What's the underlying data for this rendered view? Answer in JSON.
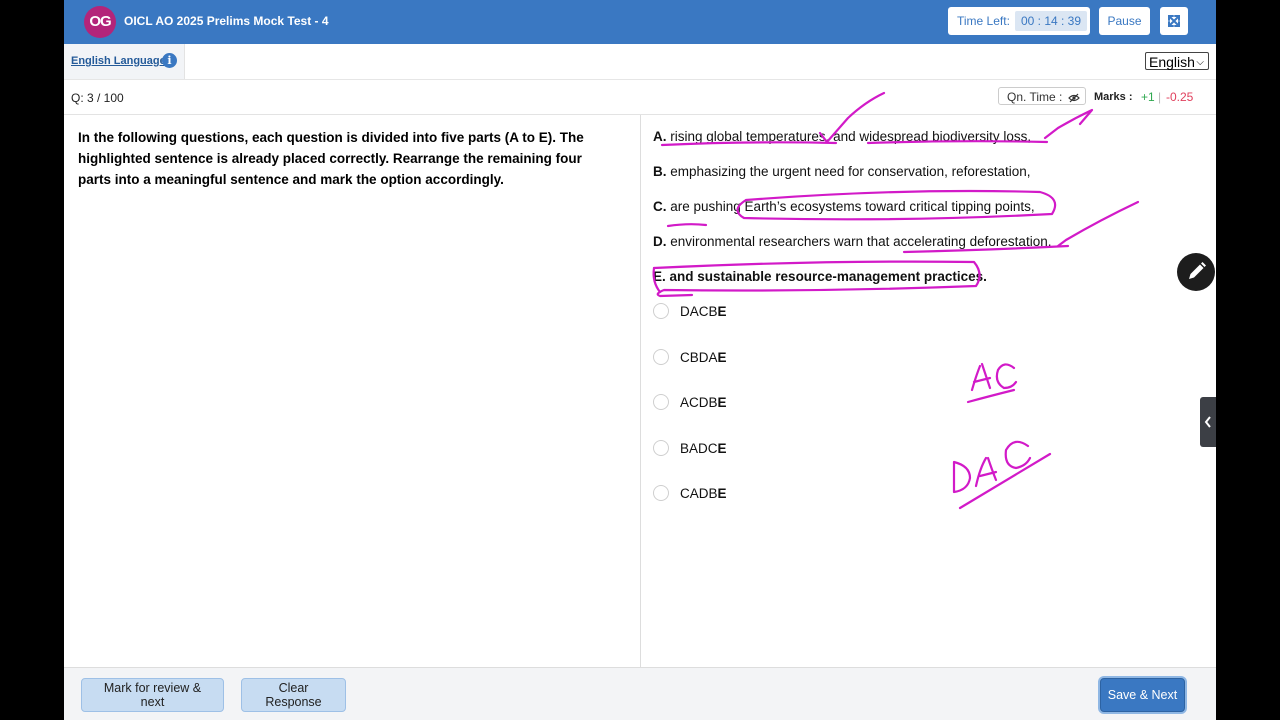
{
  "header": {
    "logo_text": "OG",
    "title": "OICL AO 2025 Prelims Mock Test - 4",
    "time_left_label": "Time Left:",
    "time_left_value": "00 : 14 : 39",
    "pause_label": "Pause"
  },
  "section": {
    "name": "English Language",
    "info_glyph": "i"
  },
  "language": {
    "selected": "English"
  },
  "question_bar": {
    "number": "Q: 3 / 100",
    "qn_time_label": "Qn. Time :",
    "marks_label": "Marks :",
    "positive": "+1",
    "separator": "|",
    "negative": "-0.25"
  },
  "question": {
    "text": "In the following questions, each question is divided into five parts (A to E). The highlighted sentence is already placed correctly. Rearrange the remaining four parts into a meaningful sentence and mark the option accordingly.",
    "parts": [
      {
        "letter": "A.",
        "text": " rising global temperatures, and widespread biodiversity loss,"
      },
      {
        "letter": "B.",
        "text": " emphasizing the urgent need for conservation, reforestation,"
      },
      {
        "letter": "C.",
        "text": " are pushing Earth’s ecosystems toward critical tipping points,"
      },
      {
        "letter": "D.",
        "text": " environmental researchers warn that accelerating deforestation,"
      },
      {
        "letter": "E.",
        "text": " and sustainable resource-management practices."
      }
    ],
    "options": [
      {
        "prefix": "DACB",
        "suffix": "E"
      },
      {
        "prefix": "CBDA",
        "suffix": "E"
      },
      {
        "prefix": "ACDB",
        "suffix": "E"
      },
      {
        "prefix": "BADC",
        "suffix": "E"
      },
      {
        "prefix": "CADB",
        "suffix": "E"
      }
    ]
  },
  "footer": {
    "mark_review_label": "Mark for review & next",
    "clear_label": "Clear Response",
    "save_next_label": "Save & Next"
  },
  "colors": {
    "brand": "#3a78c2",
    "logo": "#b3257a",
    "annotation_ink": "#d21ac8",
    "positive_mark": "#2fa84f",
    "negative_mark": "#e0405d"
  }
}
